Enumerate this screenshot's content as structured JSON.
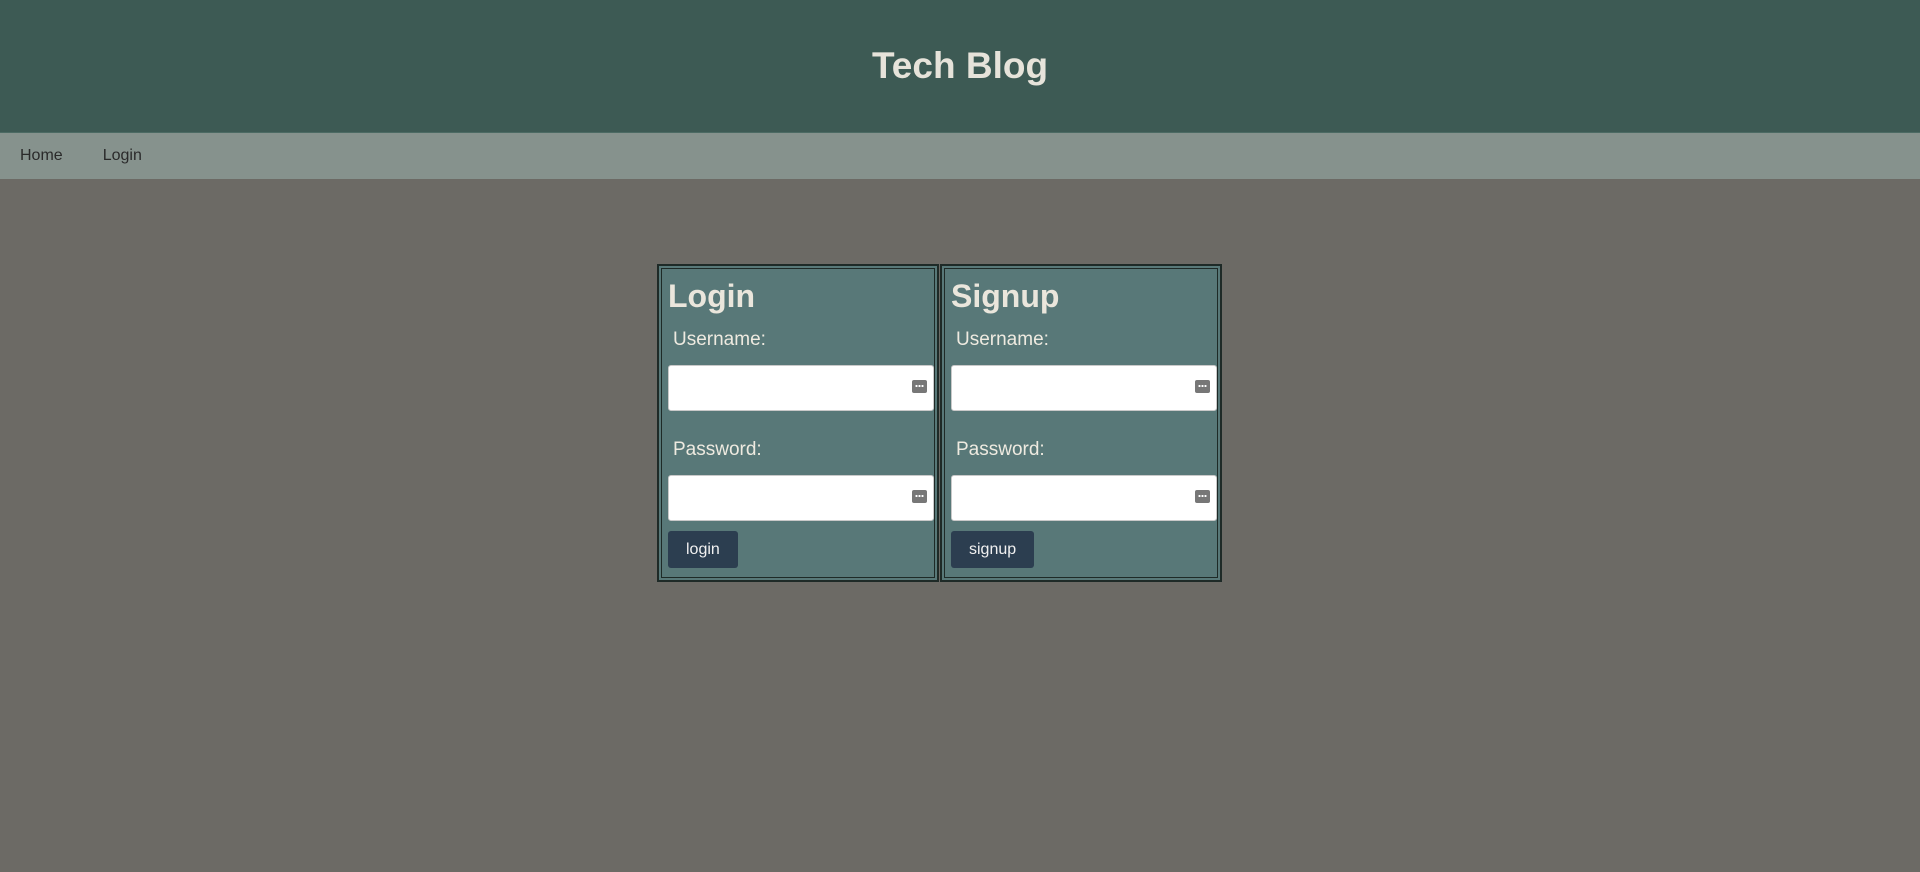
{
  "header": {
    "title": "Tech Blog"
  },
  "nav": {
    "items": [
      "Home",
      "Login"
    ]
  },
  "login": {
    "title": "Login",
    "username_label": "Username:",
    "password_label": "Password:",
    "username_value": "",
    "password_value": "",
    "button_label": "login"
  },
  "signup": {
    "title": "Signup",
    "username_label": "Username:",
    "password_label": "Password:",
    "username_value": "",
    "password_value": "",
    "button_label": "signup"
  },
  "colors": {
    "header_bg": "#3d5a54",
    "nav_bg": "#86928d",
    "page_bg": "#6c6a65",
    "card_bg": "#587878",
    "button_bg": "#2c3e50"
  }
}
